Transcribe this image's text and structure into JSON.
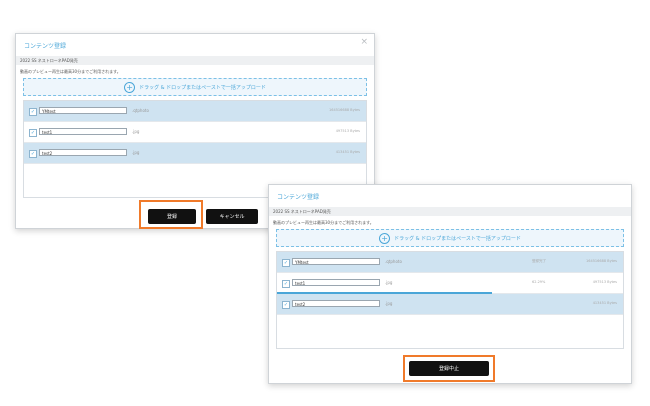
{
  "dialog1": {
    "title": "コンテンツ登録",
    "close": "×",
    "subtitle": "2022 SS ネストローネPAD発売",
    "info": "動画のプレビュー再生は最高30分までご利用されます。",
    "drop_label": "ドラッグ & ドロップまたはペーストで一括アップロード",
    "plus": "+",
    "files": [
      {
        "name": "YMtest",
        "ext": ".qtphoto",
        "size": "164516688 Bytes",
        "selected": true
      },
      {
        "name": "test1",
        "ext": ".jpg",
        "size": "497513 Bytes",
        "selected": false
      },
      {
        "name": "test2",
        "ext": ".jpg",
        "size": "413451 Bytes",
        "selected": true
      }
    ],
    "register_label": "登録",
    "cancel_label": "キャンセル"
  },
  "dialog2": {
    "title": "コンテンツ登録",
    "subtitle": "2022 SS ネストローネPAD発売",
    "info": "動画のプレビュー再生は最高30分までご利用されます。",
    "drop_label": "ドラッグ & ドロップまたはペーストで一括アップロード",
    "plus": "+",
    "files": [
      {
        "name": "YMtest",
        "ext": ".qtphoto",
        "status": "登録完了",
        "size": "164516688 Bytes",
        "selected": true
      },
      {
        "name": "test1",
        "ext": ".jpg",
        "status": "62.29%",
        "size": "497513 Bytes",
        "selected": false,
        "progress": 0.62
      },
      {
        "name": "test2",
        "ext": ".jpg",
        "status": "",
        "size": "413451 Bytes",
        "selected": true
      }
    ],
    "stop_label": "登録中止"
  },
  "check": "✓",
  "colors": {
    "accent": "#4aa6d8",
    "highlight": "#f07a2a",
    "selected_row": "#cfe3f1"
  }
}
